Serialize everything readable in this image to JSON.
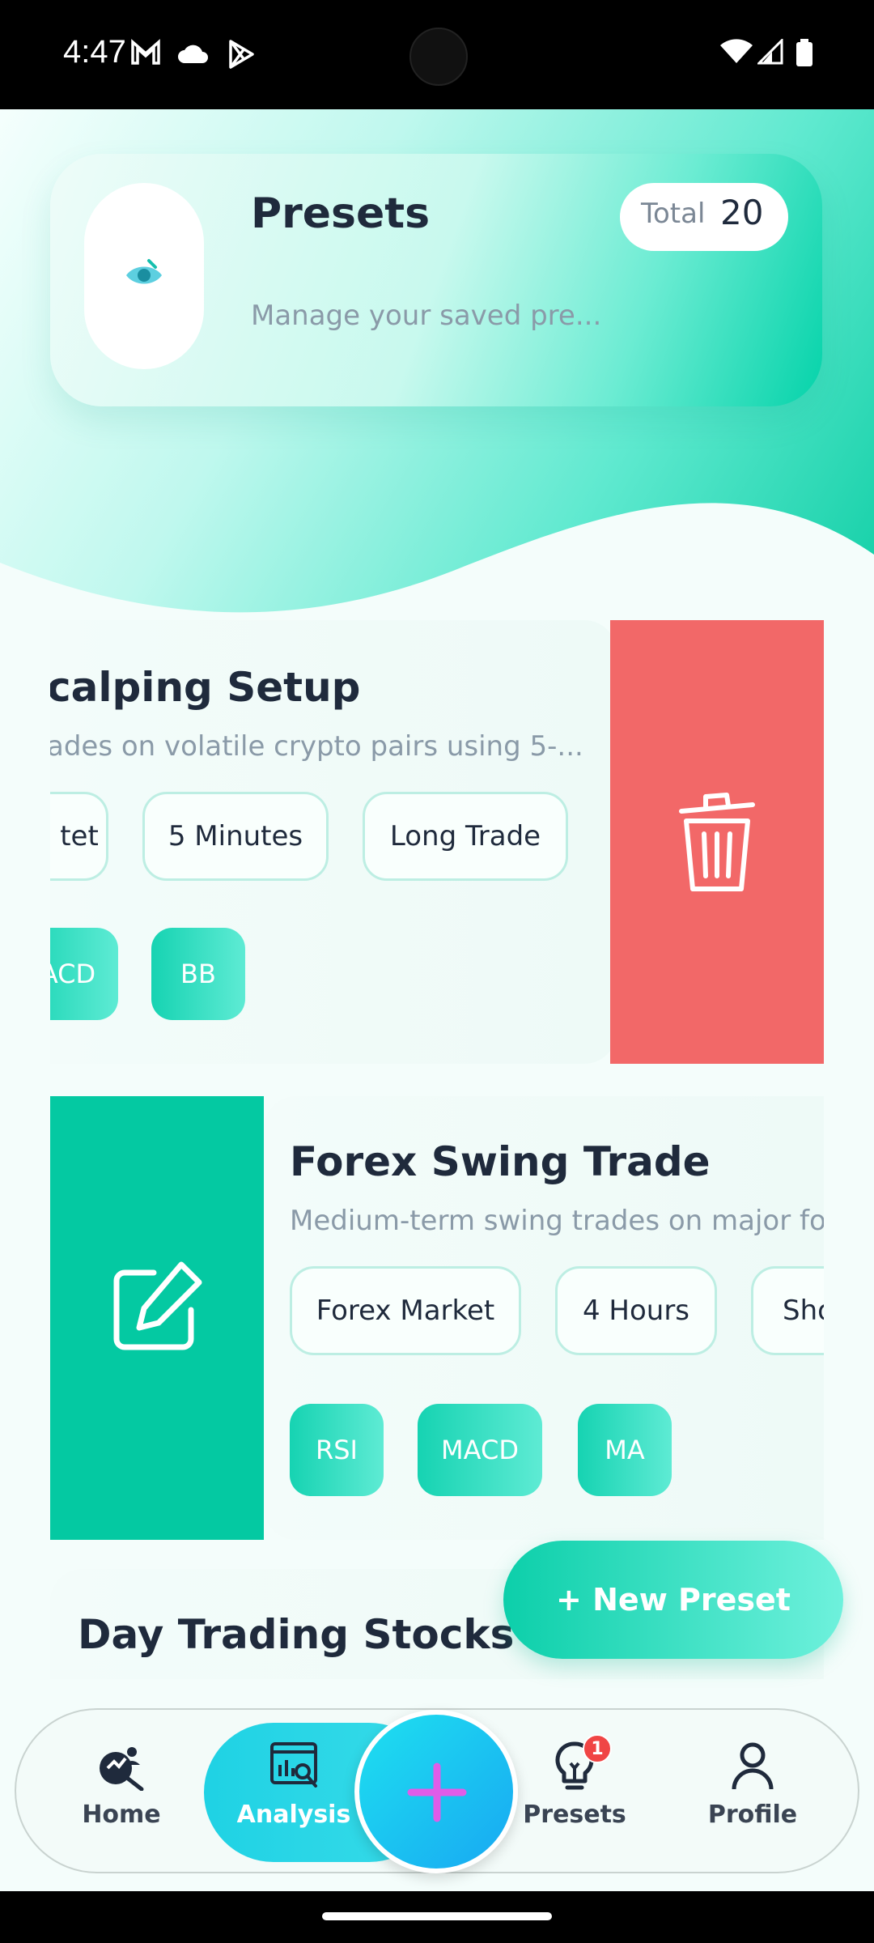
{
  "status_bar": {
    "time": "4:47"
  },
  "header": {
    "title": "Presets",
    "subtitle": "Manage your saved pre...",
    "total_label": "Total",
    "total_value": "20"
  },
  "presets": [
    {
      "name": "calping Setup",
      "description": "ades on volatile crypto pairs using 5-...",
      "tags": [
        "tet",
        "5 Minutes",
        "Long Trade"
      ],
      "indicators": [
        "ACD",
        "BB"
      ],
      "swipe_action": "delete"
    },
    {
      "name": "Forex Swing Trade",
      "description": "Medium-term swing trades on major fo",
      "tags": [
        "Forex Market",
        "4 Hours",
        "Sho"
      ],
      "indicators": [
        "RSI",
        "MACD",
        "MA"
      ],
      "swipe_action": "edit"
    },
    {
      "name": "Day Trading Stocks"
    }
  ],
  "new_preset_button": {
    "label": "+  New Preset"
  },
  "bottom_nav": {
    "items": [
      {
        "label": "Home",
        "icon": "home-analytics-icon"
      },
      {
        "label": "Analysis",
        "icon": "analysis-icon",
        "active": true
      },
      {
        "label": "Presets",
        "icon": "lightbulb-icon",
        "badge": "1"
      },
      {
        "label": "Profile",
        "icon": "profile-icon"
      }
    ],
    "fab_icon": "plus-icon"
  },
  "colors": {
    "accent": "#04c9a2",
    "delete": "#f26868",
    "text_dark": "#1f2a3c",
    "text_muted": "#8a9aa8",
    "fab": "#18a8f2",
    "fab_plus": "#e05ce8"
  }
}
